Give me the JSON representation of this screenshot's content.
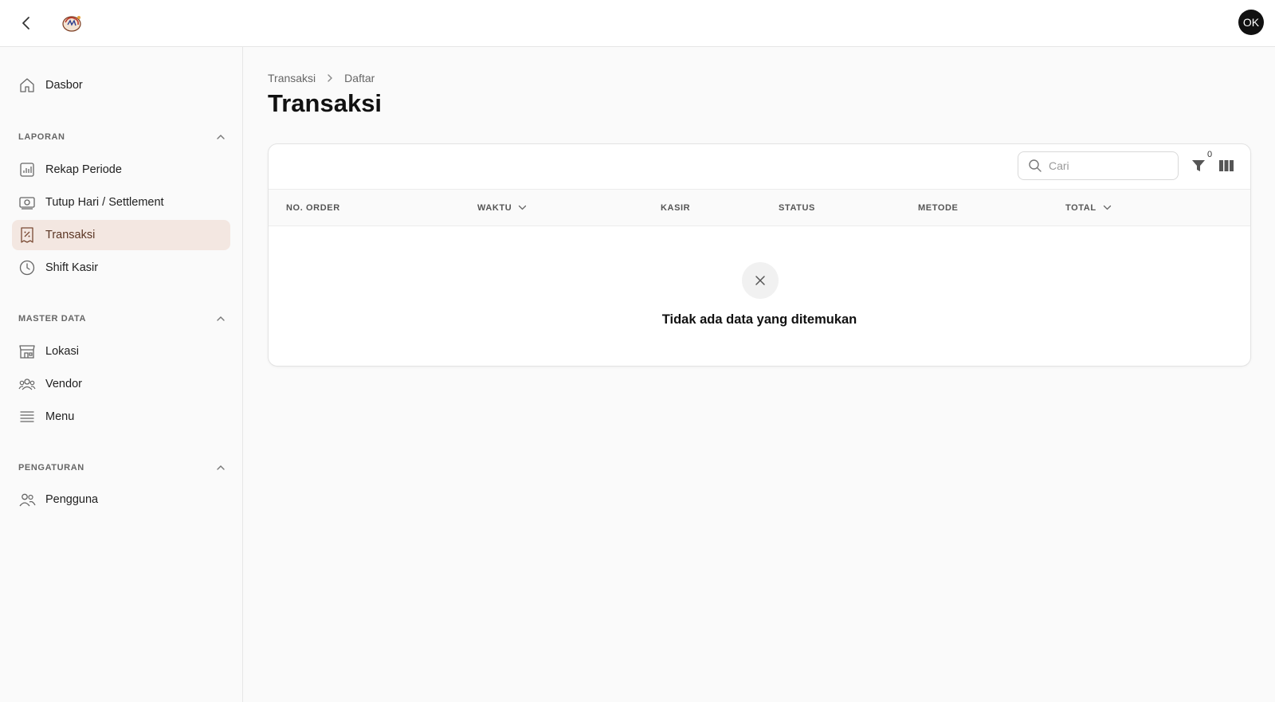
{
  "header": {
    "avatar_initials": "OK",
    "back_icon": "chevron-left-icon",
    "logo_icon": "brand-logo-icon"
  },
  "sidebar": {
    "dashboard": {
      "label": "Dasbor",
      "icon": "home-icon"
    },
    "sections": [
      {
        "title": "LAPORAN",
        "items": [
          {
            "label": "Rekap Periode",
            "icon": "bar-chart-icon"
          },
          {
            "label": "Tutup Hari / Settlement",
            "icon": "banknote-icon"
          },
          {
            "label": "Transaksi",
            "icon": "receipt-icon",
            "active": true
          },
          {
            "label": "Shift Kasir",
            "icon": "clock-icon"
          }
        ]
      },
      {
        "title": "MASTER DATA",
        "items": [
          {
            "label": "Lokasi",
            "icon": "store-icon"
          },
          {
            "label": "Vendor",
            "icon": "users-group-icon"
          },
          {
            "label": "Menu",
            "icon": "menu-list-icon"
          }
        ]
      },
      {
        "title": "PENGATURAN",
        "items": [
          {
            "label": "Pengguna",
            "icon": "users-icon"
          }
        ]
      }
    ]
  },
  "breadcrumb": {
    "items": [
      "Transaksi",
      "Daftar"
    ]
  },
  "page": {
    "title": "Transaksi"
  },
  "toolbar": {
    "search_placeholder": "Cari",
    "search_value": "",
    "filter_count": "0"
  },
  "table": {
    "columns": [
      "NO. ORDER",
      "WAKTU",
      "KASIR",
      "STATUS",
      "METODE",
      "TOTAL"
    ],
    "sortable": [
      "WAKTU",
      "TOTAL"
    ],
    "rows": [],
    "empty_message": "Tidak ada data yang ditemukan"
  },
  "colors": {
    "active_bg": "#f3e7e1",
    "active_text": "#5b3624",
    "avatar_bg": "#111111"
  }
}
